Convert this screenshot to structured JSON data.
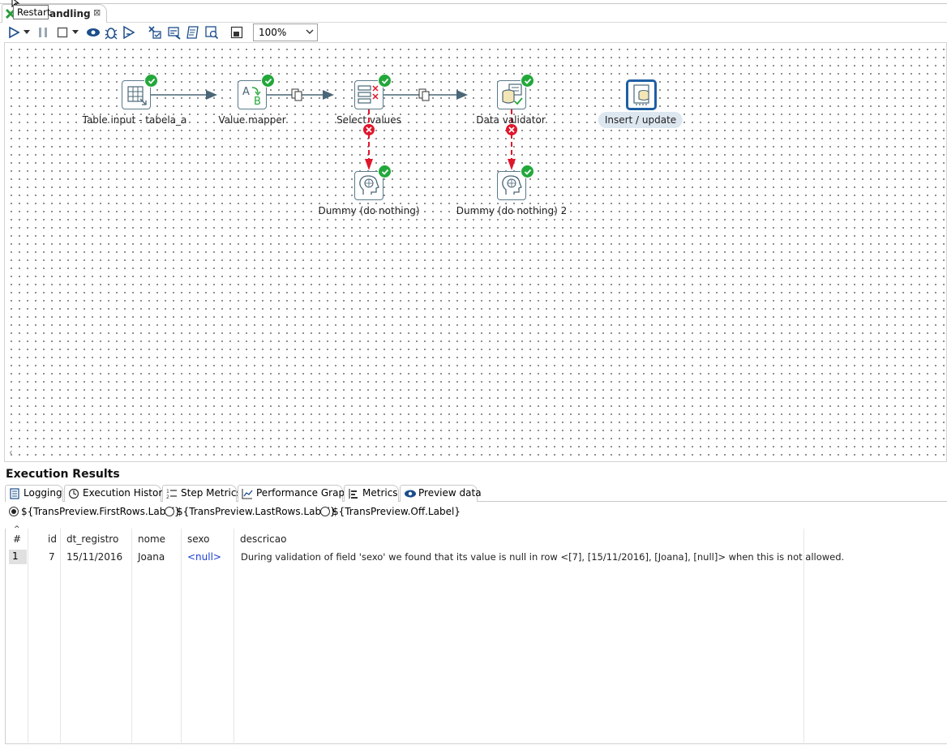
{
  "tooltip": "Restart",
  "file_tab": {
    "title": "andling",
    "close": "⊠"
  },
  "toolbar": {
    "zoom": "100%",
    "buttons": [
      "run-icon",
      "run-dropdown-icon",
      "pause-icon",
      "stop-icon",
      "stop-dropdown-icon",
      "preview-icon",
      "debug-icon",
      "replay-icon",
      "verify-icon",
      "impact-icon",
      "sql-icon",
      "explore-db-icon",
      "show-results-icon"
    ]
  },
  "canvas": {
    "steps": [
      {
        "name": "table-input",
        "label": "Table input - tabela_a",
        "icon": "table-input-icon"
      },
      {
        "name": "value-mapper",
        "label": "Value mapper",
        "icon": "value-mapper-icon"
      },
      {
        "name": "select-values",
        "label": "Select values",
        "icon": "select-values-icon"
      },
      {
        "name": "data-validator",
        "label": "Data validator",
        "icon": "data-validator-icon"
      },
      {
        "name": "insert-update",
        "label": "Insert / update",
        "icon": "insert-update-icon"
      },
      {
        "name": "dummy-1",
        "label": "Dummy (do nothing)",
        "icon": "dummy-icon"
      },
      {
        "name": "dummy-2",
        "label": "Dummy (do nothing) 2",
        "icon": "dummy-icon"
      }
    ],
    "colors": {
      "hop": "#4a6777",
      "error_hop": "#e0162b",
      "ok": "#22a83a",
      "selected": "#1f5fa3"
    },
    "scroll_left": "‹"
  },
  "results": {
    "title": "Execution Results",
    "tabs": [
      {
        "label": "Logging",
        "icon": "logging-icon"
      },
      {
        "label": "Execution History",
        "icon": "history-icon"
      },
      {
        "label": "Step Metrics",
        "icon": "step-metrics-icon"
      },
      {
        "label": "Performance Graph",
        "icon": "performance-graph-icon"
      },
      {
        "label": "Metrics",
        "icon": "metrics-icon"
      },
      {
        "label": "Preview data",
        "icon": "preview-eye-icon",
        "active": true
      }
    ],
    "radios": [
      {
        "label": "${TransPreview.FirstRows.Label}",
        "checked": true
      },
      {
        "label": "${TransPreview.LastRows.Label}",
        "checked": false
      },
      {
        "label": "${TransPreview.Off.Label}",
        "checked": false
      }
    ],
    "table": {
      "sort_indicator": "^",
      "columns": [
        "#",
        "id",
        "dt_registro",
        "nome",
        "sexo",
        "descricao"
      ],
      "rows": [
        [
          "1",
          "7",
          "15/11/2016",
          "Joana",
          "<null>",
          "During validation of field 'sexo' we found that its value is null in row <[7], [15/11/2016], [Joana], [null]> when this is not allowed."
        ]
      ]
    }
  }
}
